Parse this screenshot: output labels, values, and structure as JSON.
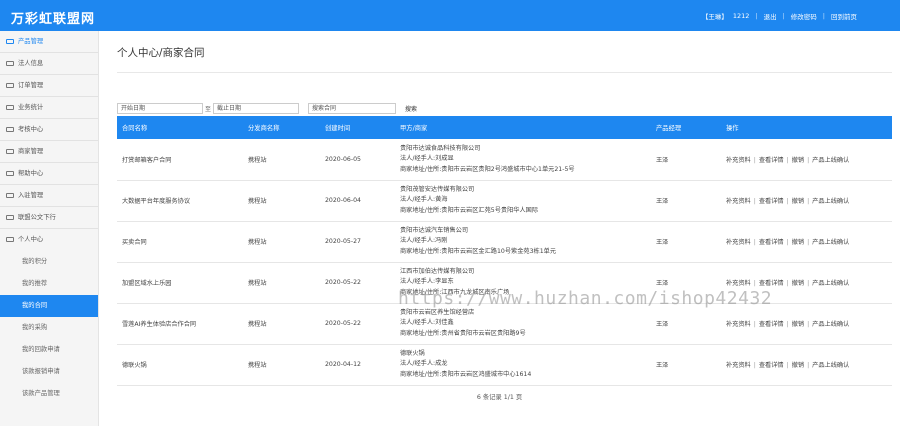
{
  "header": {
    "app_title": "万彩虹联盟网",
    "user_label": "【王琳】",
    "user_id": "1212",
    "logout": "退出",
    "change_password": "修改密码",
    "back_home": "回到前页"
  },
  "sidebar": {
    "items": [
      {
        "label": "产品管理"
      },
      {
        "label": "法人信息"
      },
      {
        "label": "订单管理"
      },
      {
        "label": "业务统计"
      },
      {
        "label": "考核中心"
      },
      {
        "label": "商家管理"
      },
      {
        "label": "帮助中心"
      },
      {
        "label": "入驻管理"
      },
      {
        "label": "联盟公文下行"
      },
      {
        "label": "个人中心"
      }
    ],
    "sub_items": [
      {
        "label": "我的积分"
      },
      {
        "label": "我的推荐"
      },
      {
        "label": "我的合同",
        "active": true
      },
      {
        "label": "我的采购"
      },
      {
        "label": "我的回款申请"
      },
      {
        "label": "该款报销申请"
      },
      {
        "label": "该款产品管理"
      }
    ]
  },
  "main": {
    "page_title": "个人中心/商家合同",
    "filters": {
      "start_placeholder": "开始日期",
      "to_label": "至",
      "end_placeholder": "截止日期",
      "keyword_placeholder": "搜索合同",
      "search_button": "搜索"
    },
    "table": {
      "columns": [
        "合同名称",
        "分发商名称",
        "创建时间",
        "甲方/商家",
        "产品经理",
        "操作"
      ],
      "rows": [
        {
          "name": "打赏邮箱客户合同",
          "dist": "携程站",
          "date": "2020-06-05",
          "company": "贵阳市达诚食品科技有限公司",
          "legal": "法人/经手人:刘成显",
          "address": "商家地址/住所:贵阳市云岩区贵阳2号鸿盛城市中心1单元21-5号",
          "manager": "王泽"
        },
        {
          "name": "大数据平台年度服务协议",
          "dist": "携程站",
          "date": "2020-06-04",
          "company": "贵阳茂管安达传媒有限公司",
          "legal": "法人/经手人:黄海",
          "address": "商家地址/住所:贵阳市云岩区汇苑5号贵阳华人国际",
          "manager": "王泽"
        },
        {
          "name": "买卖合同",
          "dist": "携程站",
          "date": "2020-05-27",
          "company": "贵阳市达诚汽车销售公司",
          "legal": "法人/经手人:冯刚",
          "address": "商家地址/住所:贵阳市云岩区金汇路10号紫金苑3栋1单元",
          "manager": "王泽"
        },
        {
          "name": "加盟区域水上乐园",
          "dist": "携程站",
          "date": "2020-05-22",
          "company": "江西市加伯达传媒有限公司",
          "legal": "法人/经手人:李显东",
          "address": "商家地址/住所:江西市九龙城区南乐广场",
          "manager": "王泽"
        },
        {
          "name": "雪莲AI养生体验店合作合同",
          "dist": "携程站",
          "date": "2020-05-22",
          "company": "贵阳市云岩区养生馆经营店",
          "legal": "法人/经手人:刘佳鑫",
          "address": "商家地址/住所:贵州省贵阳市云岩区贵阳路9号",
          "manager": "王泽"
        },
        {
          "name": "德联火锅",
          "dist": "携程站",
          "date": "2020-04-12",
          "company": "德联火锅",
          "legal": "法人/经手人:成龙",
          "address": "商家地址/住所:贵阳市云岩区鸿盛城市中心1614",
          "manager": "王泽"
        }
      ],
      "ops": [
        "补充资料",
        "查看详情",
        "撤销",
        "产品上线确认"
      ]
    },
    "pager_text": "6 条记录 1/1 页"
  },
  "watermark": "https://www.huzhan.com/ishop42432"
}
